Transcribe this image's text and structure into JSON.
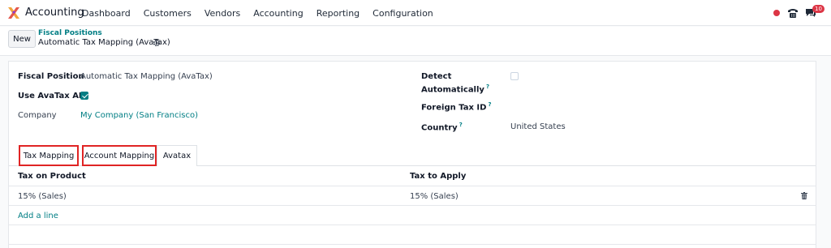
{
  "navbar": {
    "app_name": "Accounting",
    "menu": [
      "Dashboard",
      "Customers",
      "Vendors",
      "Accounting",
      "Reporting",
      "Configuration"
    ],
    "chat_badge": "10",
    "accent_color": "#017e84",
    "status_color": "#dc3545"
  },
  "control_panel": {
    "new_label": "New",
    "breadcrumb_parent": "Fiscal Positions",
    "breadcrumb_current": "Automatic Tax Mapping (AvaTax)"
  },
  "form": {
    "fiscal_position_label": "Fiscal Position",
    "fiscal_position_value": "Automatic Tax Mapping (AvaTax)",
    "use_avatax_label": "Use AvaTax API",
    "use_avatax_checked": true,
    "company_label": "Company",
    "company_value": "My Company (San Francisco)",
    "detect_label_1": "Detect",
    "detect_label_2": "Automatically",
    "detect_help": "?",
    "detect_checked": false,
    "foreign_tax_label": "Foreign Tax ID",
    "foreign_tax_help": "?",
    "country_label": "Country",
    "country_help": "?",
    "country_value": "United States"
  },
  "tabs": [
    "Tax Mapping",
    "Account Mapping",
    "Avatax"
  ],
  "table": {
    "columns": [
      "Tax on Product",
      "Tax to Apply"
    ],
    "rows": [
      [
        "15% (Sales)",
        "15% (Sales)"
      ]
    ],
    "add_line": "Add a line"
  }
}
